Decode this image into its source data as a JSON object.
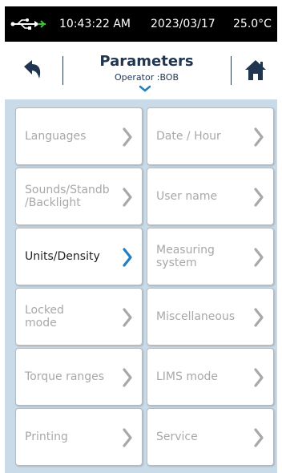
{
  "status": {
    "time": "10:43:22 AM",
    "date": "2023/03/17",
    "temperature": "25.0°C",
    "usb_icon": "usb-icon",
    "usb_color": "#3fc23a"
  },
  "header": {
    "title": "Parameters",
    "operator": "Operator :BOB",
    "back_icon": "back-arrow-icon",
    "home_icon": "home-icon",
    "accent_color": "#1f7fc0"
  },
  "menu": {
    "items": [
      {
        "label": "Languages",
        "state": "disabled"
      },
      {
        "label": "Date / Hour",
        "state": "disabled"
      },
      {
        "label": "Sounds/Standb\n/Backlight",
        "state": "disabled"
      },
      {
        "label": "User name",
        "state": "disabled"
      },
      {
        "label": "Units/Density",
        "state": "active"
      },
      {
        "label": "Measuring\nsystem",
        "state": "disabled"
      },
      {
        "label": "Locked\nmode",
        "state": "disabled"
      },
      {
        "label": "Miscellaneous",
        "state": "disabled"
      },
      {
        "label": "Torque ranges",
        "state": "disabled"
      },
      {
        "label": "LIMS mode",
        "state": "disabled"
      },
      {
        "label": "Printing",
        "state": "disabled"
      },
      {
        "label": "Service",
        "state": "disabled"
      }
    ]
  }
}
